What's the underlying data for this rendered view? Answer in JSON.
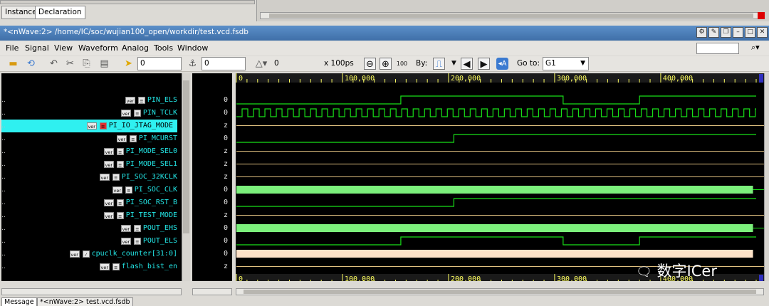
{
  "top_panel": {
    "tabs": [
      "Instance",
      "Declaration"
    ],
    "active_tab": 1
  },
  "window": {
    "title": "*<nWave:2> /home/IC/soc/wujian100_open/workdir/test.vcd.fsdb"
  },
  "menus": [
    "File",
    "Signal",
    "View",
    "Waveform",
    "Analog",
    "Tools",
    "Window"
  ],
  "toolbar": {
    "cursor_time": "0",
    "marker_time": "0",
    "delta": "0",
    "time_unit": "x 100ps",
    "by_label": "By:",
    "goto_label": "Go to:",
    "goto_value": "G1"
  },
  "signals": [
    {
      "name": "PIN_ELS",
      "value": "0",
      "kind": "bit",
      "selected": false
    },
    {
      "name": "PIN_TCLK",
      "value": "0",
      "kind": "bit",
      "selected": false
    },
    {
      "name": "PI_IO_JTAG_MODE",
      "value": "z",
      "kind": "bit",
      "selected": true
    },
    {
      "name": "PI_MCURST",
      "value": "0",
      "kind": "bit",
      "selected": false
    },
    {
      "name": "PI_MODE_SEL0",
      "value": "z",
      "kind": "bit",
      "selected": false
    },
    {
      "name": "PI_MODE_SEL1",
      "value": "z",
      "kind": "bit",
      "selected": false
    },
    {
      "name": "PI_SOC_32KCLK",
      "value": "z",
      "kind": "bit",
      "selected": false
    },
    {
      "name": "PI_SOC_CLK",
      "value": "0",
      "kind": "bit",
      "selected": false
    },
    {
      "name": "PI_SOC_RST_B",
      "value": "0",
      "kind": "bit",
      "selected": false
    },
    {
      "name": "PI_TEST_MODE",
      "value": "z",
      "kind": "bit",
      "selected": false
    },
    {
      "name": "POUT_EHS",
      "value": "0",
      "kind": "bit",
      "selected": false
    },
    {
      "name": "POUT_ELS",
      "value": "0",
      "kind": "bit",
      "selected": false
    },
    {
      "name": "cpuclk_counter[31:0]",
      "value": "0",
      "kind": "bus",
      "selected": false
    },
    {
      "name": "flash_bist_en",
      "value": "z",
      "kind": "bit",
      "selected": false
    }
  ],
  "badge_text": "ver",
  "timeline": {
    "min": 0,
    "max": 490000,
    "major_ticks": [
      "0",
      "100,000",
      "200,000",
      "300,000",
      "400,000"
    ]
  },
  "waves": [
    {
      "type": "digital",
      "edges": [
        [
          0,
          0
        ],
        [
          155000,
          1
        ],
        [
          308000,
          0
        ],
        [
          380000,
          1
        ]
      ]
    },
    {
      "type": "clock",
      "period": 10750
    },
    {
      "type": "z"
    },
    {
      "type": "digital",
      "edges": [
        [
          0,
          0
        ],
        [
          205000,
          1
        ]
      ]
    },
    {
      "type": "z"
    },
    {
      "type": "z"
    },
    {
      "type": "z"
    },
    {
      "type": "dense",
      "end": 487000
    },
    {
      "type": "digital",
      "edges": [
        [
          0,
          0
        ],
        [
          205000,
          1
        ]
      ]
    },
    {
      "type": "z"
    },
    {
      "type": "dense",
      "end": 487000
    },
    {
      "type": "digital",
      "edges": [
        [
          0,
          0
        ],
        [
          155000,
          1
        ],
        [
          308000,
          0
        ],
        [
          380000,
          1
        ]
      ]
    },
    {
      "type": "bus",
      "end": 487000
    },
    {
      "type": "z"
    }
  ],
  "colors": {
    "wave": "#18e018",
    "z_line": "#e0c080",
    "dense_fill": "#7cf07c",
    "bus_fill": "#fde2c8",
    "signal_name": "#23e6e6",
    "selected_row": "#2ff0f0",
    "ruler_text": "#ffff60"
  },
  "bottom_tabs": [
    "Message",
    "*<nWave:2> test.vcd.fsdb"
  ],
  "watermark": "数字ICer"
}
